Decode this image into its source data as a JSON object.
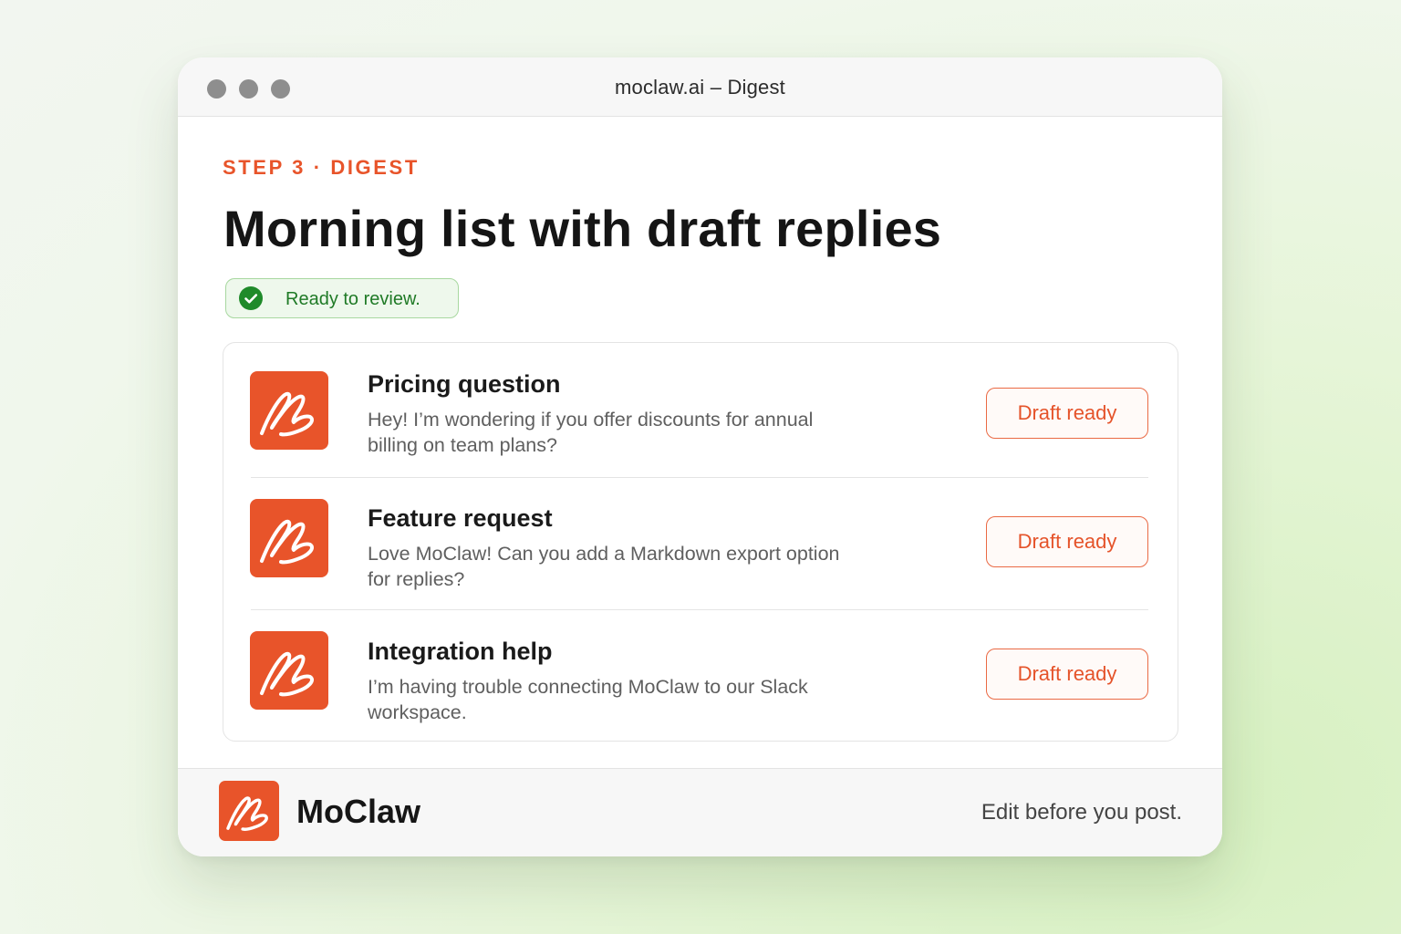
{
  "window": {
    "title": "moclaw.ai – Digest"
  },
  "header": {
    "step_label": "STEP 3 · DIGEST",
    "headline": "Morning list with draft replies",
    "status": {
      "text": "Ready to review.",
      "icon": "check-circle-icon",
      "color": "#1f7a26"
    }
  },
  "digest": {
    "items": [
      {
        "title": "Pricing question",
        "body": "Hey! I’m wondering if you offer discounts for annual billing on team plans?",
        "action_label": "Draft ready",
        "icon": "moclaw-logo-icon"
      },
      {
        "title": "Feature request",
        "body": "Love MoClaw! Can you add a Markdown export option for replies?",
        "action_label": "Draft ready",
        "icon": "moclaw-logo-icon"
      },
      {
        "title": "Integration help",
        "body": "I’m having trouble connecting MoClaw to our Slack workspace.",
        "action_label": "Draft ready",
        "icon": "moclaw-logo-icon"
      }
    ]
  },
  "footer": {
    "brand": "MoClaw",
    "tagline": "Edit before you post.",
    "logo_icon": "moclaw-logo-icon"
  },
  "colors": {
    "accent": "#e8542a",
    "success": "#1f7a26",
    "success_bg": "#eef8ec"
  }
}
